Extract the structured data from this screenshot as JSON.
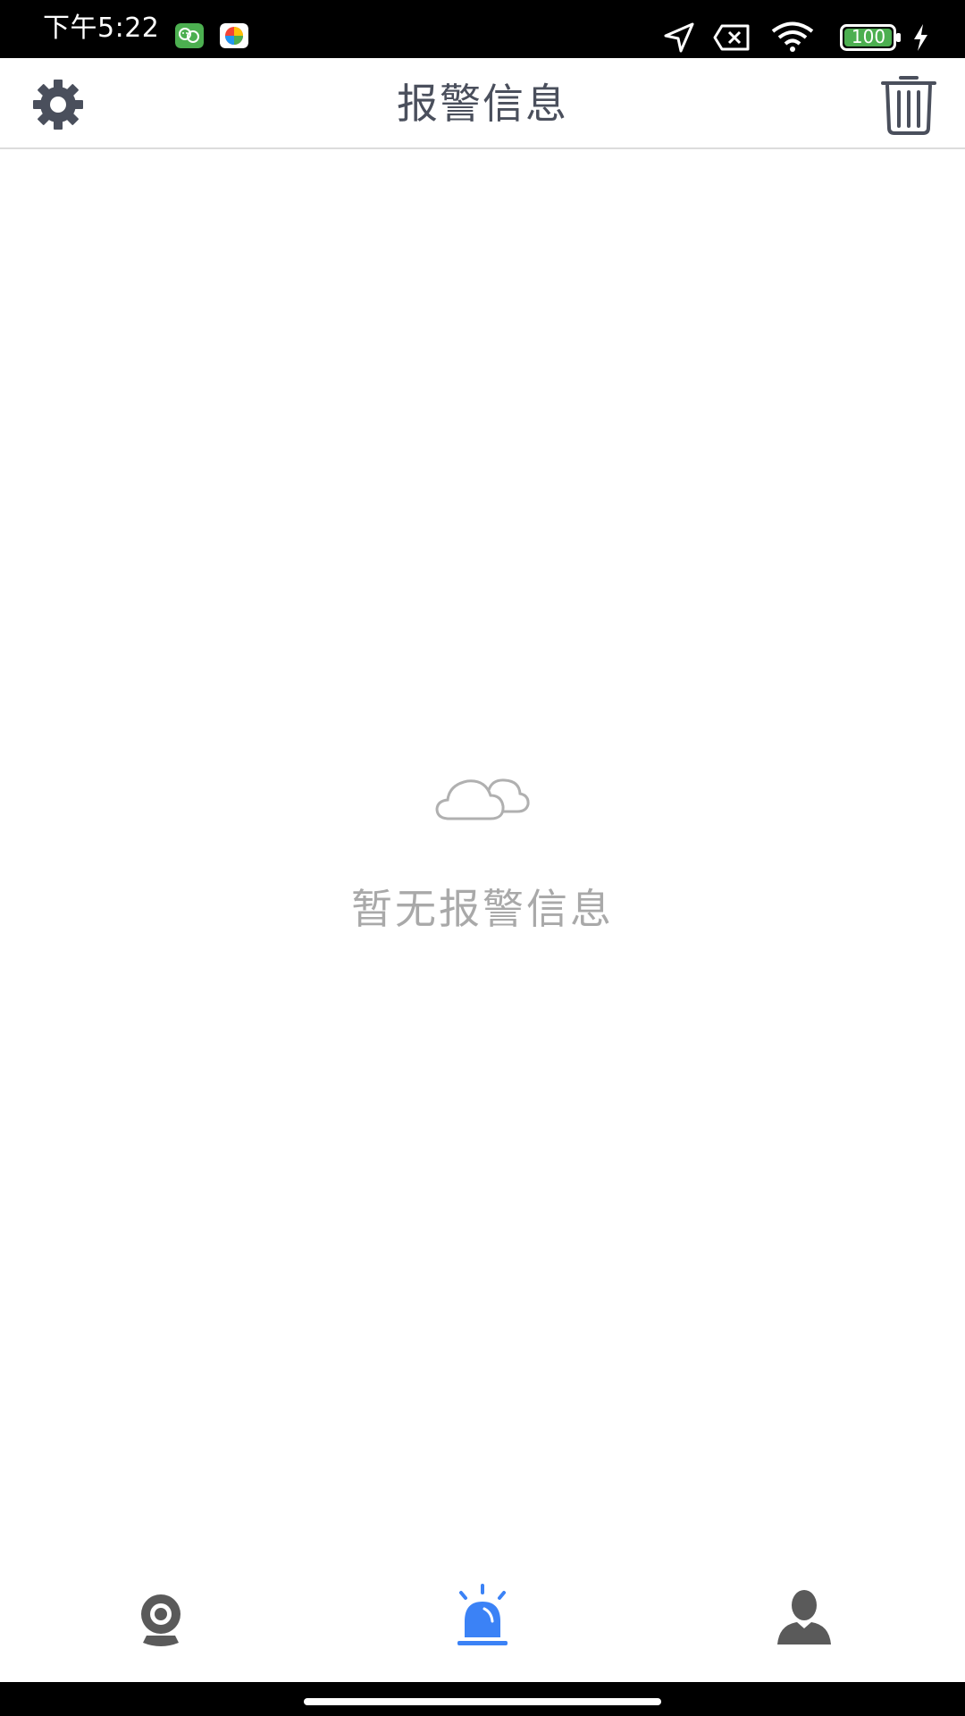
{
  "status_bar": {
    "time": "下午5:22",
    "battery": "100"
  },
  "header": {
    "title": "报警信息"
  },
  "empty_state": {
    "message": "暂无报警信息"
  },
  "bottom_nav": {
    "items": [
      {
        "icon": "camera-icon",
        "active": false
      },
      {
        "icon": "alarm-siren-icon",
        "active": true
      },
      {
        "icon": "person-icon",
        "active": false
      }
    ]
  },
  "colors": {
    "header_text": "#4a4f5c",
    "empty_text": "#a9a9a9",
    "active_tab": "#3b82f6",
    "inactive_tab": "#5a5a5a",
    "battery_fill": "#4caf50"
  }
}
